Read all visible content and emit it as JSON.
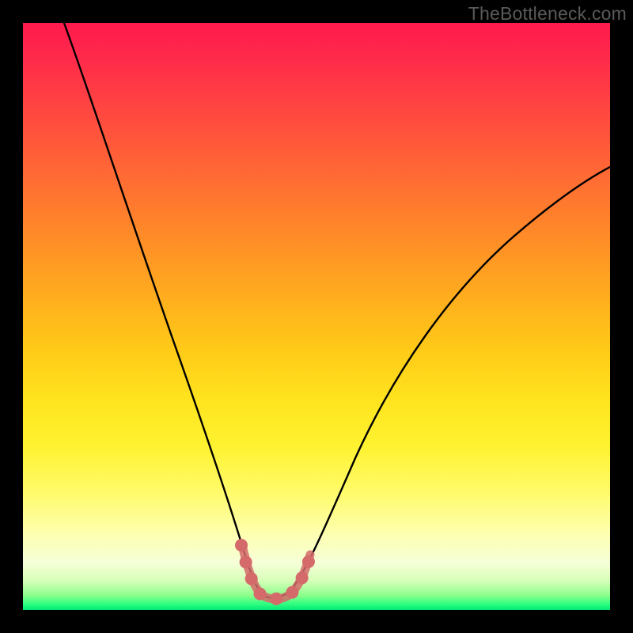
{
  "watermark": "TheBottleneck.com",
  "chart_data": {
    "type": "line",
    "title": "",
    "xlabel": "",
    "ylabel": "",
    "xlim": [
      0,
      100
    ],
    "ylim": [
      0,
      100
    ],
    "grid": false,
    "series": [
      {
        "name": "main-curve",
        "color": "#000000",
        "x": [
          7,
          10,
          14,
          18,
          22,
          26,
          30,
          33,
          35,
          37,
          38.5,
          40,
          41,
          42.5,
          44,
          46,
          48,
          50,
          53,
          57,
          62,
          68,
          75,
          83,
          92,
          100
        ],
        "y": [
          100,
          91,
          79,
          67,
          56,
          45,
          34,
          25,
          19,
          13,
          9,
          6,
          4,
          3,
          3,
          4,
          6,
          10,
          16,
          24,
          33,
          42,
          51,
          59,
          66,
          72
        ]
      },
      {
        "name": "highlight-valley",
        "color": "#d86a6a",
        "x": [
          37.5,
          38.5,
          39.5,
          40.5,
          41.5,
          42.5,
          43.5,
          44.5,
          45.5,
          46.5,
          47.5
        ],
        "y": [
          10,
          7,
          5,
          3.8,
          3.2,
          3,
          3.2,
          3.8,
          5,
          7,
          10
        ]
      }
    ],
    "background_gradient": {
      "top": "#ff1a4d",
      "mid": "#ffe31e",
      "bottom": "#00e676"
    }
  }
}
